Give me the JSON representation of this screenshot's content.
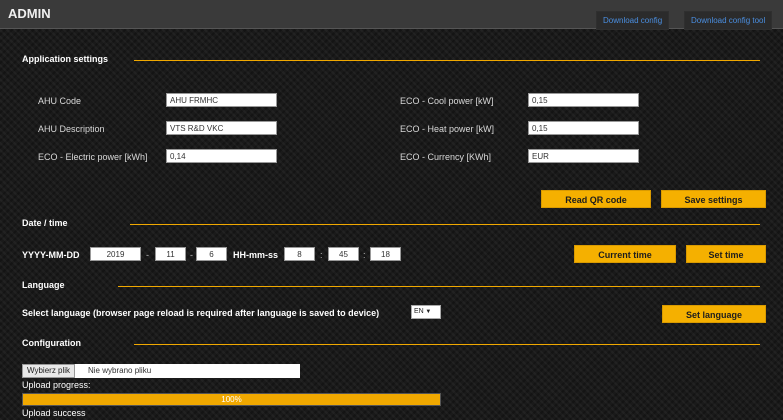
{
  "header": {
    "title": "ADMIN",
    "download_config": "Download config",
    "download_config_tool": "Download config tool"
  },
  "application_settings": {
    "title": "Application settings",
    "ahu_code": {
      "label": "AHU Code",
      "value": "AHU FRMHC"
    },
    "ahu_description": {
      "label": "AHU Description",
      "value": "VTS R&D VKC"
    },
    "eco_electric": {
      "label": "ECO - Electric power [kWh]",
      "value": "0,14"
    },
    "eco_cool": {
      "label": "ECO - Cool power [kW]",
      "value": "0,15"
    },
    "eco_heat": {
      "label": "ECO - Heat power [kW]",
      "value": "0,15"
    },
    "eco_currency": {
      "label": "ECO - Currency [KWh]",
      "value": "EUR"
    },
    "read_qr_label": "Read QR code",
    "save_label": "Save settings"
  },
  "date_time": {
    "title": "Date / time",
    "date_label": "YYYY-MM-DD",
    "year": "2019",
    "month": "11",
    "day": "6",
    "time_label": "HH-mm-ss",
    "hour": "8",
    "minute": "45",
    "second": "18",
    "dash": "-",
    "colon": ":",
    "current_time_label": "Current time",
    "set_time_label": "Set time"
  },
  "language": {
    "title": "Language",
    "select_label": "Select language (browser page reload is required after language is saved to device)",
    "selected": "EN",
    "set_label": "Set language"
  },
  "configuration": {
    "title": "Configuration",
    "file_button": "Wybierz plik",
    "file_status": "Nie wybrano pliku",
    "upload_progress_label": "Upload progress:",
    "progress_percent": 100,
    "progress_text": "100%",
    "upload_status": "Upload success"
  },
  "colors": {
    "accent": "#f5b000",
    "link": "#4a8ee0",
    "background": "#1a1a1a"
  }
}
